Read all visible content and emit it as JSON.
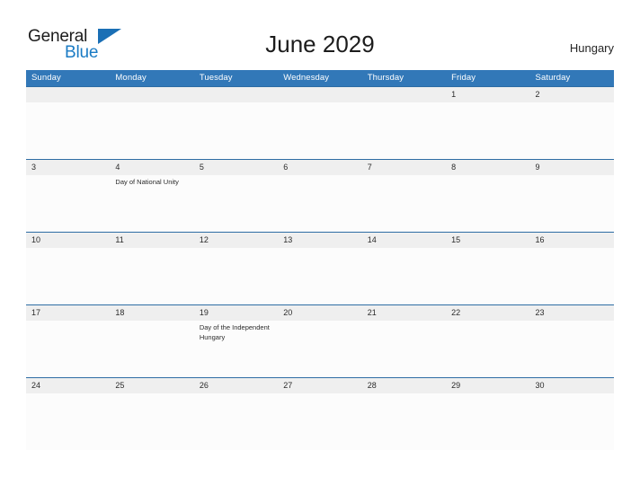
{
  "brand": {
    "name_part1": "General",
    "name_part2": "Blue"
  },
  "header": {
    "title": "June 2029",
    "country": "Hungary"
  },
  "calendar": {
    "weekdays": [
      "Sunday",
      "Monday",
      "Tuesday",
      "Wednesday",
      "Thursday",
      "Friday",
      "Saturday"
    ],
    "accent_color": "#3278b8",
    "divider_color": "#2e6da4",
    "band_color": "#efefef",
    "weeks": [
      [
        {
          "day": "",
          "event": ""
        },
        {
          "day": "",
          "event": ""
        },
        {
          "day": "",
          "event": ""
        },
        {
          "day": "",
          "event": ""
        },
        {
          "day": "",
          "event": ""
        },
        {
          "day": "1",
          "event": ""
        },
        {
          "day": "2",
          "event": ""
        }
      ],
      [
        {
          "day": "3",
          "event": ""
        },
        {
          "day": "4",
          "event": "Day of National Unity"
        },
        {
          "day": "5",
          "event": ""
        },
        {
          "day": "6",
          "event": ""
        },
        {
          "day": "7",
          "event": ""
        },
        {
          "day": "8",
          "event": ""
        },
        {
          "day": "9",
          "event": ""
        }
      ],
      [
        {
          "day": "10",
          "event": ""
        },
        {
          "day": "11",
          "event": ""
        },
        {
          "day": "12",
          "event": ""
        },
        {
          "day": "13",
          "event": ""
        },
        {
          "day": "14",
          "event": ""
        },
        {
          "day": "15",
          "event": ""
        },
        {
          "day": "16",
          "event": ""
        }
      ],
      [
        {
          "day": "17",
          "event": ""
        },
        {
          "day": "18",
          "event": ""
        },
        {
          "day": "19",
          "event": "Day of the Independent Hungary"
        },
        {
          "day": "20",
          "event": ""
        },
        {
          "day": "21",
          "event": ""
        },
        {
          "day": "22",
          "event": ""
        },
        {
          "day": "23",
          "event": ""
        }
      ],
      [
        {
          "day": "24",
          "event": ""
        },
        {
          "day": "25",
          "event": ""
        },
        {
          "day": "26",
          "event": ""
        },
        {
          "day": "27",
          "event": ""
        },
        {
          "day": "28",
          "event": ""
        },
        {
          "day": "29",
          "event": ""
        },
        {
          "day": "30",
          "event": ""
        }
      ]
    ]
  }
}
